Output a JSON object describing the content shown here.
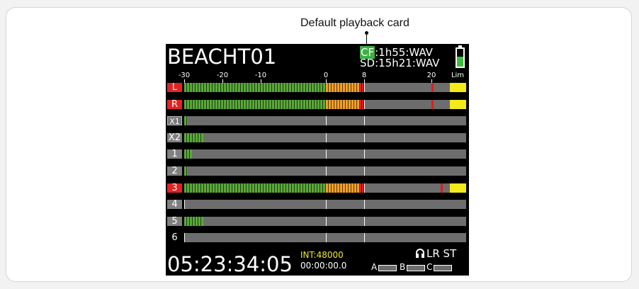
{
  "callout": {
    "text": "Default playback card"
  },
  "screen": {
    "filename": "BEACHT01",
    "media": {
      "cf_badge": "CF",
      "cf_rest": ":1h55:WAV",
      "sd_line": "SD:15h21:WAV"
    },
    "battery": {
      "icon": "battery-icon",
      "level": 0.55,
      "color": "#3cc03c"
    },
    "scale": {
      "labels": [
        "-30",
        "-20",
        "-10",
        "0",
        "8",
        "20",
        "Lim"
      ]
    },
    "channels": [
      {
        "label": "L",
        "style": "red",
        "level_db": 8,
        "peak_db": 20
      },
      {
        "label": "R",
        "style": "red",
        "level_db": 8,
        "peak_db": 20
      },
      {
        "label": "X1",
        "style": "outline",
        "level_db": -29,
        "peak_db": null
      },
      {
        "label": "X2",
        "style": "grey",
        "level_db": -25,
        "peak_db": null
      },
      {
        "label": "1",
        "style": "grey",
        "level_db": -28,
        "peak_db": null
      },
      {
        "label": "2",
        "style": "grey",
        "level_db": -29,
        "peak_db": null
      },
      {
        "label": "3",
        "style": "red",
        "level_db": 8,
        "peak_db": 25
      },
      {
        "label": "4",
        "style": "grey",
        "level_db": null,
        "peak_db": null
      },
      {
        "label": "5",
        "style": "grey",
        "level_db": -25,
        "peak_db": null
      },
      {
        "label": "6",
        "style": "plain",
        "level_db": null,
        "peak_db": null
      }
    ],
    "timecode": "05:23:34:05",
    "sample_rate": "INT:48000",
    "counter": "00:00:00.0",
    "monitor": {
      "icon": "headphones-icon",
      "text": "LR ST"
    },
    "buses": [
      "A",
      "B",
      "C"
    ],
    "colors": {
      "green": "#5aa83a",
      "orange": "#f0a02c",
      "red": "#e32222",
      "yellow": "#f2ea1a",
      "track": "#6d6d6d"
    }
  }
}
